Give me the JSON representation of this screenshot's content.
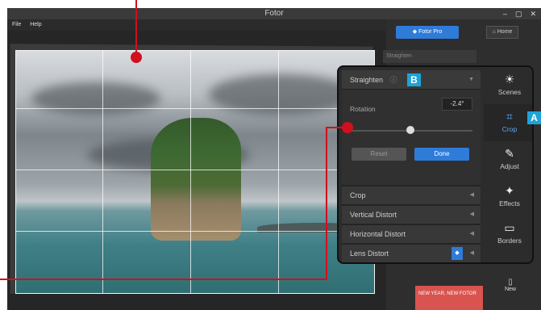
{
  "window": {
    "title": "Fotor",
    "controls": [
      "–",
      "▢",
      "✕"
    ]
  },
  "menu": {
    "items": [
      "File",
      "Help"
    ]
  },
  "header": {
    "fotor_pro": "Fotor Pro",
    "home": "Home"
  },
  "background_panel": {
    "straighten": "Straighten"
  },
  "popup": {
    "straighten": {
      "label": "Straighten",
      "rotation_label": "Rotation",
      "rotation_value": "-2.4°",
      "reset": "Reset",
      "done": "Done",
      "slider_value": "-2.4"
    },
    "sections": [
      {
        "label": "Crop"
      },
      {
        "label": "Vertical Distort"
      },
      {
        "label": "Horizontal Distort"
      },
      {
        "label": "Lens Distort"
      }
    ]
  },
  "sidebar": {
    "items": [
      {
        "label": "Scenes",
        "icon": "sun-icon"
      },
      {
        "label": "Crop",
        "icon": "crop-icon"
      },
      {
        "label": "Adjust",
        "icon": "pencil-icon"
      },
      {
        "label": "Effects",
        "icon": "sparkle-icon"
      },
      {
        "label": "Borders",
        "icon": "frame-icon"
      }
    ],
    "new": "New"
  },
  "promo": {
    "title": "NEW YEAR, NEW FOTOR"
  },
  "callouts": {
    "a": "A",
    "b": "B"
  },
  "colors": {
    "accent": "#2f7bd8",
    "callout": "#1da4d6",
    "pointer": "#d0101e"
  }
}
